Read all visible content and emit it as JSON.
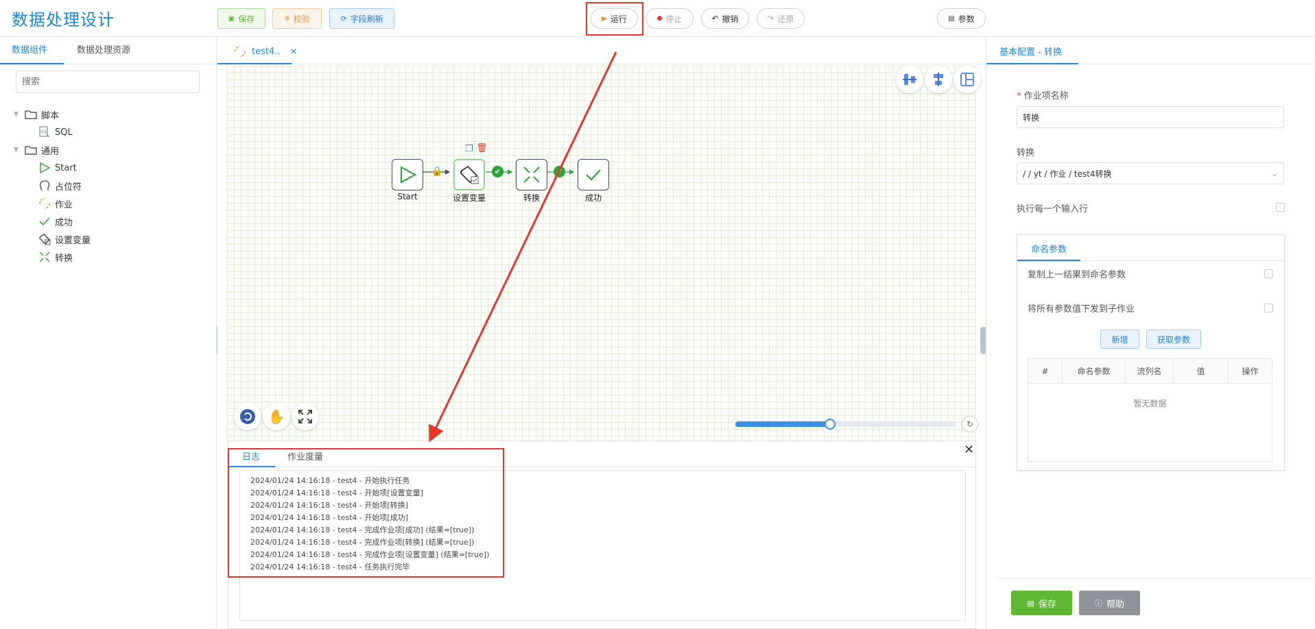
{
  "app": {
    "title": "数据处理设计"
  },
  "toolbar": {
    "save": "保存",
    "validate": "校验",
    "refresh_fields": "字段刷新",
    "run": "运行",
    "stop": "停止",
    "undo": "撤销",
    "redo": "还原",
    "params": "参数"
  },
  "left": {
    "tabs": [
      "数据组件",
      "数据处理资源"
    ],
    "search_placeholder": "搜索",
    "tree": {
      "folder_script": "脚本",
      "sql": "SQL",
      "folder_general": "通用",
      "start": "Start",
      "placeholder": "占位符",
      "job": "作业",
      "success": "成功",
      "set_var": "设置变量",
      "transform": "转换"
    }
  },
  "editor": {
    "tab": "test4..",
    "nodes": {
      "start": "Start",
      "set_var": "设置变量",
      "transform": "转换",
      "success": "成功"
    },
    "zoom_level": 0.43,
    "log": {
      "tabs": [
        "日志",
        "作业度量"
      ],
      "lines": [
        "2024/01/24 14:16:18 - test4 - 开始执行任务",
        "2024/01/24 14:16:18 - test4 - 开始项[设置变量]",
        "2024/01/24 14:16:18 - test4 - 开始项[转换]",
        "2024/01/24 14:16:18 - test4 - 开始项[成功]",
        "2024/01/24 14:16:18 - test4 - 完成作业项[成功] (结果=[true])",
        "2024/01/24 14:16:18 - test4 - 完成作业项[转换] (结果=[true])",
        "2024/01/24 14:16:18 - test4 - 完成作业项[设置变量] (结果=[true])",
        "2024/01/24 14:16:18 - test4 - 任务执行完毕"
      ]
    }
  },
  "right": {
    "title": "基本配置 - 转换",
    "job_name_label": "作业项名称",
    "job_name_value": "转换",
    "transform_label": "转换",
    "transform_value": "/ / yt / 作业 / test4转换",
    "each_row_label": "执行每一个输入行",
    "params_tab": "命名参数",
    "copy_prev": "复制上一结果到命名参数",
    "pass_all": "将所有参数值下发到子作业",
    "add_btn": "新增",
    "get_params_btn": "获取参数",
    "table_headers": [
      "#",
      "命名参数",
      "流列名",
      "值",
      "操作"
    ],
    "empty": "暂无数据",
    "save_btn": "保存",
    "help_btn": "帮助"
  },
  "colors": {
    "accent": "#1a87e6",
    "success": "#5fb832",
    "danger": "#e8352a"
  }
}
